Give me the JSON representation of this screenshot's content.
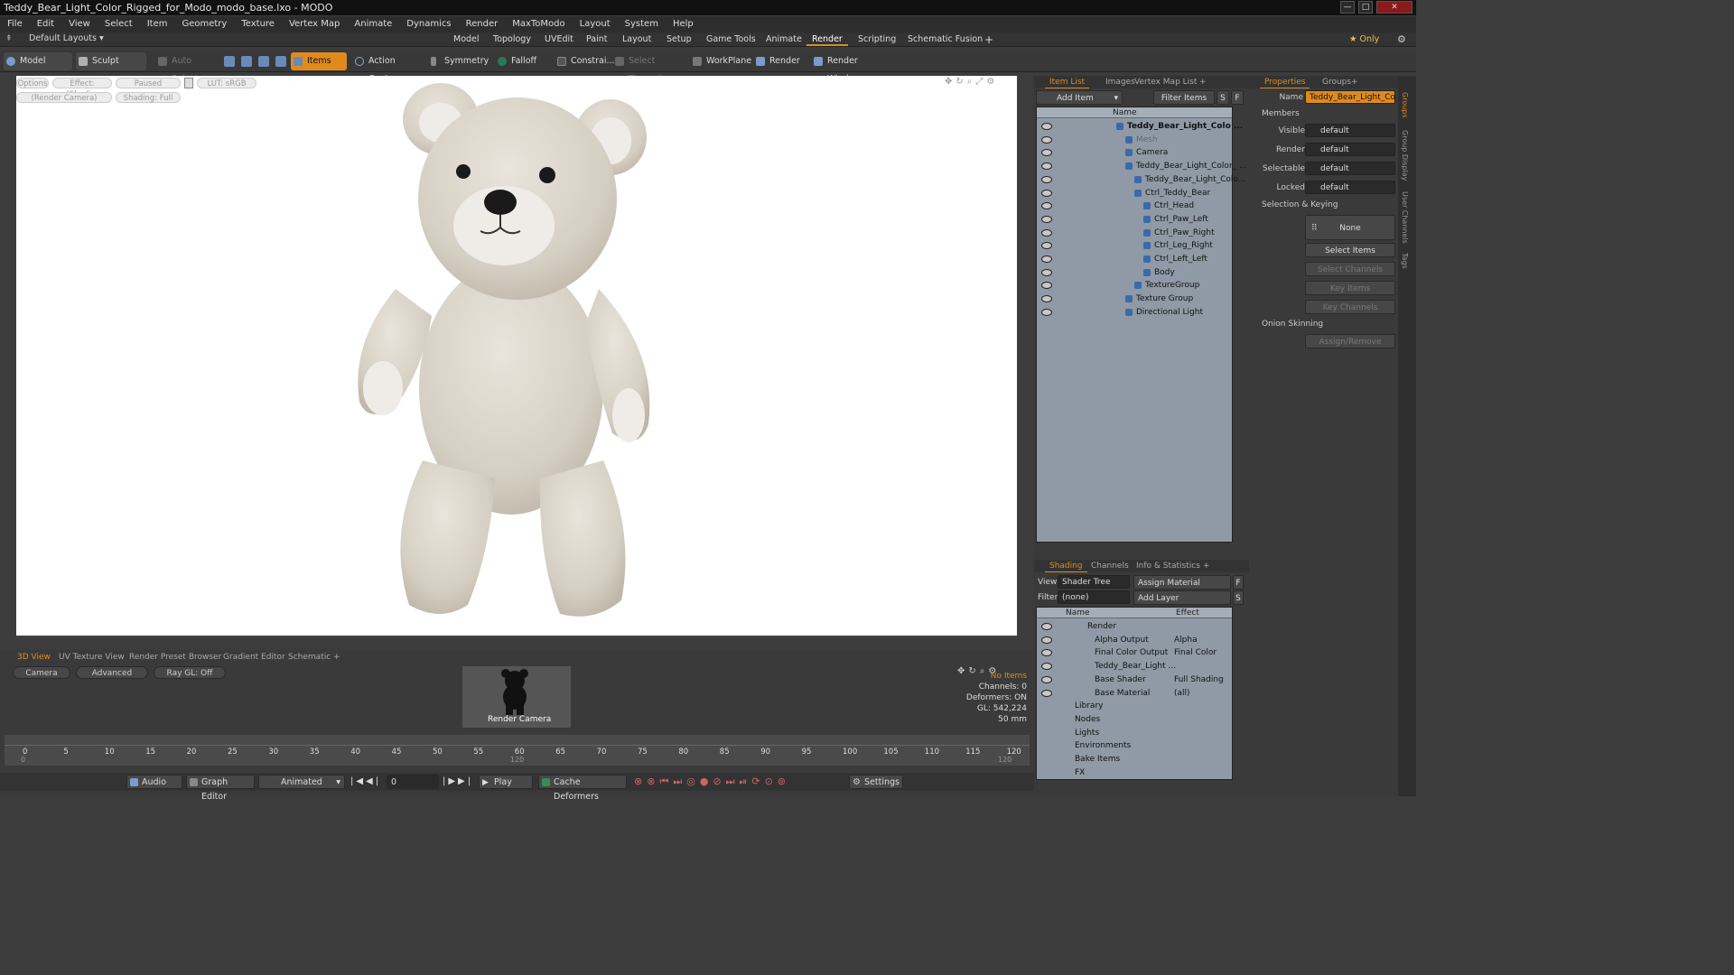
{
  "window": {
    "title": "Teddy_Bear_Light_Color_Rigged_for_Modo_modo_base.lxo - MODO",
    "minimize": "—",
    "maximize": "□",
    "close": "✕"
  },
  "menu": [
    "File",
    "Edit",
    "View",
    "Select",
    "Item",
    "Geometry",
    "Texture",
    "Vertex Map",
    "Animate",
    "Dynamics",
    "Render",
    "MaxToModo",
    "Layout",
    "System",
    "Help"
  ],
  "layoutbar": {
    "layout_dropdown": "Default Layouts ▾",
    "tabs": [
      "Model",
      "Topology",
      "UVEdit",
      "Paint",
      "Layout",
      "Setup",
      "Game Tools",
      "Animate",
      "Render",
      "Scripting",
      "Schematic Fusion"
    ],
    "active_tab": "Render",
    "add": "+",
    "only": "★ Only"
  },
  "toolbar": {
    "model": "Model",
    "sculpt": "Sculpt",
    "auto_select": "Auto Select",
    "items": "Items",
    "action_center": "Action Center",
    "symmetry": "Symmetry",
    "falloff": "Falloff",
    "constraints": "Constrai...",
    "select_through": "Select Through",
    "workplane": "WorkPlane",
    "render": "Render",
    "render_window": "Render Window"
  },
  "viewport": {
    "options": "Options",
    "effect": "Effect: (Shadi...",
    "paused": "Paused",
    "lut": "LUT: sRGB",
    "render_camera": "(Render Camera)",
    "shading": "Shading: Full"
  },
  "item_list": {
    "tabs": [
      "Item List",
      "Images",
      "Vertex Map List",
      "+"
    ],
    "add_item": "Add Item",
    "filter_items": "Filter Items",
    "s": "S",
    "f": "F",
    "header_name": "Name",
    "rows": [
      {
        "label": "Teddy_Bear_Light_Colo ...",
        "depth": 0,
        "bold": true
      },
      {
        "label": "Mesh",
        "depth": 1,
        "dim": true
      },
      {
        "label": "Camera",
        "depth": 1
      },
      {
        "label": "Teddy_Bear_Light_Color_ ...",
        "depth": 1
      },
      {
        "label": "Teddy_Bear_Light_Colo...",
        "depth": 2
      },
      {
        "label": "Ctrl_Teddy_Bear",
        "depth": 2
      },
      {
        "label": "Ctrl_Head",
        "depth": 3
      },
      {
        "label": "Ctrl_Paw_Left",
        "depth": 3
      },
      {
        "label": "Ctrl_Paw_Right",
        "depth": 3
      },
      {
        "label": "Ctrl_Leg_Right",
        "depth": 3
      },
      {
        "label": "Ctrl_Left_Left",
        "depth": 3
      },
      {
        "label": "Body",
        "depth": 3
      },
      {
        "label": "TextureGroup",
        "depth": 2
      },
      {
        "label": "Texture Group",
        "depth": 1
      },
      {
        "label": "Directional Light",
        "depth": 1
      }
    ]
  },
  "shading": {
    "tabs": [
      "Shading",
      "Channels",
      "Info & Statistics",
      "+"
    ],
    "view_label": "View",
    "view_value": "Shader Tree",
    "assign_material": "Assign Material",
    "f": "F",
    "filter_label": "Filter",
    "filter_value": "(none)",
    "add_layer": "Add Layer",
    "s": "S",
    "header_name": "Name",
    "header_effect": "Effect",
    "rows": [
      {
        "label": "Render",
        "effect": ""
      },
      {
        "label": "Alpha Output",
        "effect": "Alpha"
      },
      {
        "label": "Final Color Output",
        "effect": "Final Color"
      },
      {
        "label": "Teddy_Bear_Light ...",
        "effect": ""
      },
      {
        "label": "Base Shader",
        "effect": "Full Shading"
      },
      {
        "label": "Base Material",
        "effect": "(all)"
      },
      {
        "label": "Library",
        "effect": ""
      },
      {
        "label": "Nodes",
        "effect": ""
      },
      {
        "label": "Lights",
        "effect": ""
      },
      {
        "label": "Environments",
        "effect": ""
      },
      {
        "label": "Bake Items",
        "effect": ""
      },
      {
        "label": "FX",
        "effect": ""
      }
    ]
  },
  "properties": {
    "tabs": [
      "Properties",
      "Groups",
      "+"
    ],
    "name_label": "Name",
    "name_value": "Teddy_Bear_Light_Colo",
    "members": "Members",
    "visible_label": "Visible",
    "visible_value": "default",
    "render_label": "Render",
    "render_value": "default",
    "selectable_label": "Selectable",
    "selectable_value": "default",
    "locked_label": "Locked",
    "locked_value": "default",
    "selection_keying": "Selection & Keying",
    "none": "None",
    "select_items": "Select Items",
    "select_channels": "Select Channels",
    "key_items": "Key Items",
    "key_channels": "Key Channels",
    "onion_skinning": "Onion Skinning",
    "assign_remove": "Assign/Remove"
  },
  "vertical_tabs": [
    "Groups",
    "Group Display",
    "User Channels",
    "Tags"
  ],
  "bottom": {
    "tabs": [
      "3D View",
      "UV Texture View",
      "Render Preset Browser",
      "Gradient Editor",
      "Schematic",
      "+"
    ],
    "camera": "Camera",
    "advanced": "Advanced",
    "raygl": "Ray GL: Off",
    "thumb_label": "Render Camera",
    "stats": {
      "no_items": "No Items",
      "channels": "Channels: 0",
      "deformers": "Deformers: ON",
      "gl": "GL: 542,224",
      "focal": "50 mm"
    }
  },
  "timeline": {
    "ticks": [
      0,
      5,
      10,
      15,
      20,
      25,
      30,
      35,
      40,
      45,
      50,
      55,
      60,
      65,
      70,
      75,
      80,
      85,
      90,
      95,
      100,
      105,
      110,
      115,
      120
    ],
    "sub_ticks": [
      "0",
      "120",
      "120"
    ]
  },
  "transport": {
    "audio": "Audio",
    "graph_editor": "Graph Editor",
    "animated": "Animated",
    "frame": "0",
    "play": "Play",
    "cache_deformers": "Cache Deformers",
    "settings": "Settings"
  }
}
